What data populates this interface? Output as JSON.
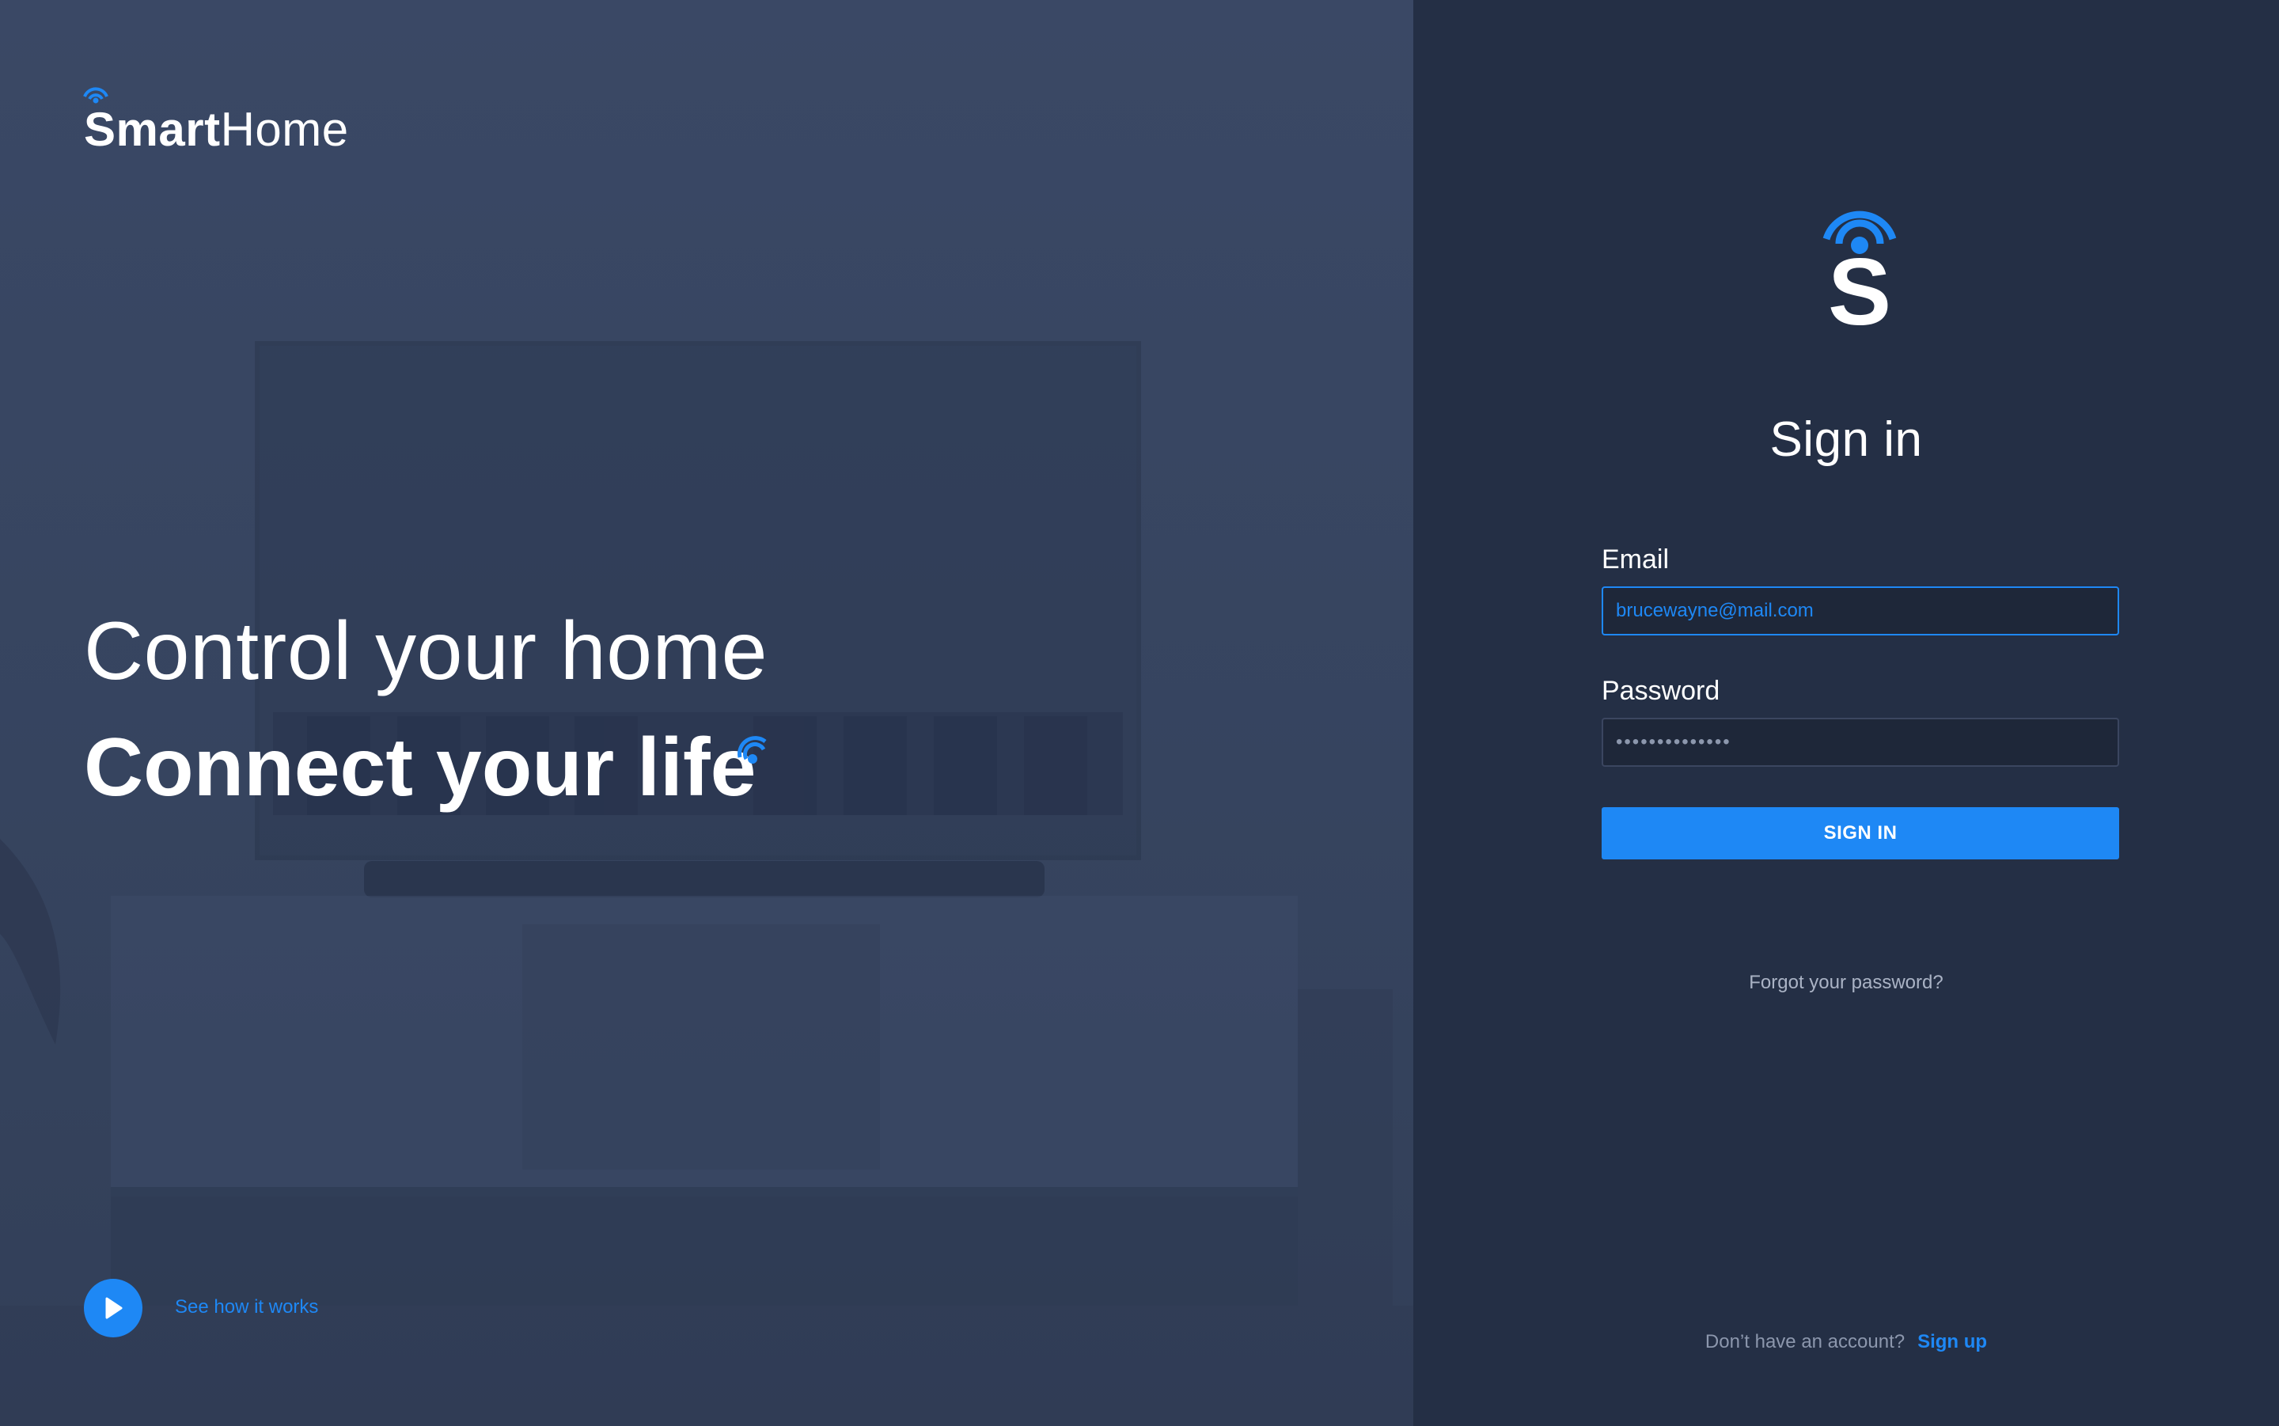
{
  "brand": {
    "name_bold": "Smart",
    "name_light": "Home"
  },
  "hero": {
    "headline": "Control your home",
    "subline": "Connect your life",
    "video_link": "See how it works"
  },
  "signin": {
    "title": "Sign in",
    "email_label": "Email",
    "email_value": "brucewayne@mail.com",
    "password_label": "Password",
    "password_value": "••••••••••••••",
    "submit_label": "SIGN IN",
    "forgot_link": "Forgot your password?",
    "signup_prompt": "Don’t have an account?",
    "signup_link": "Sign up"
  },
  "colors": {
    "accent": "#1e88f5",
    "panel_bg": "#242f45",
    "hero_overlay": "#36445f"
  },
  "icons": {
    "logo": "wifi-s-icon",
    "play": "play-icon"
  }
}
